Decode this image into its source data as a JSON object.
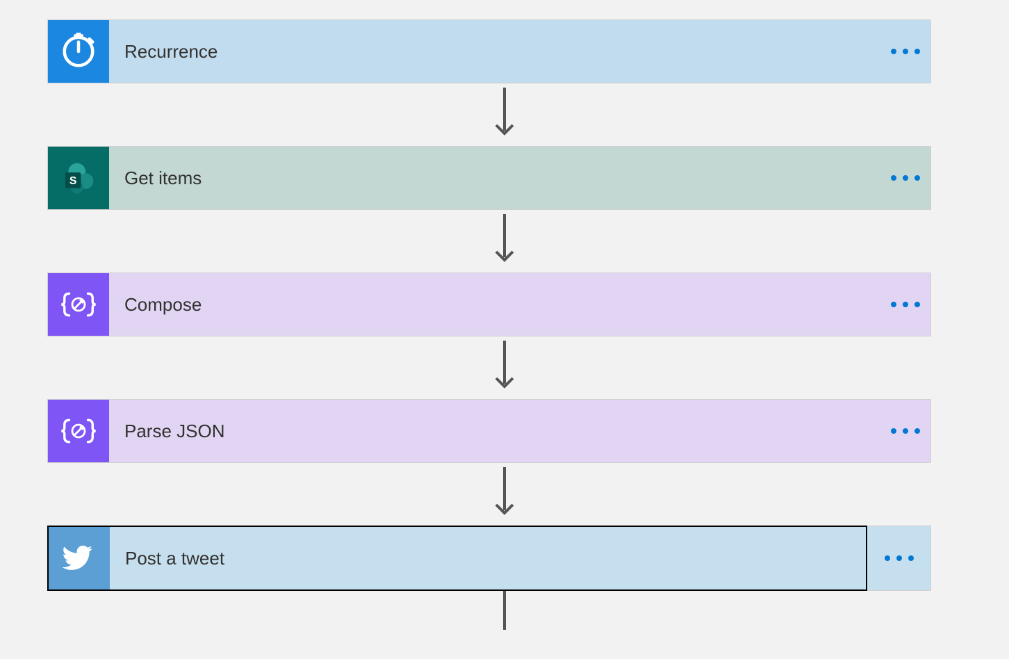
{
  "flow": {
    "steps": [
      {
        "id": "recurrence",
        "label": "Recurrence",
        "icon": "clock-icon",
        "tileClass": "tile-recurrence",
        "bodyClass": "body-recurrence"
      },
      {
        "id": "get-items",
        "label": "Get items",
        "icon": "sharepoint-icon",
        "tileClass": "tile-sharepoint",
        "bodyClass": "body-sharepoint"
      },
      {
        "id": "compose",
        "label": "Compose",
        "icon": "data-operations-icon",
        "tileClass": "tile-dataop",
        "bodyClass": "body-dataop"
      },
      {
        "id": "parse-json",
        "label": "Parse JSON",
        "icon": "data-operations-icon",
        "tileClass": "tile-dataop",
        "bodyClass": "body-dataop"
      },
      {
        "id": "post-tweet",
        "label": "Post a tweet",
        "icon": "twitter-icon",
        "tileClass": "tile-twitter",
        "bodyClass": "body-twitter",
        "selected": true
      }
    ]
  }
}
